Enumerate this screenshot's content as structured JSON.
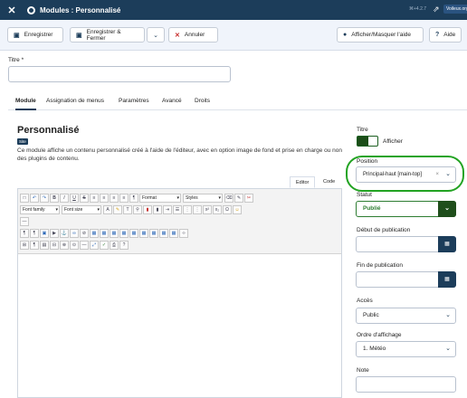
{
  "header": {
    "title": "Modules : Personnalisé",
    "version": "⌘+4.2.7",
    "site_button": "Voileux.org"
  },
  "toolbar": {
    "save": "Enregistrer",
    "save_close": "Enregistrer & Fermer",
    "cancel": "Annuler",
    "toggle_help": "Afficher/Masquer l'aide",
    "help": "Aide"
  },
  "title_field": {
    "label": "Titre *",
    "value": ""
  },
  "tabs": [
    "Module",
    "Assignation de menus",
    "Paramètres",
    "Avancé",
    "Droits"
  ],
  "module": {
    "heading": "Personnalisé",
    "badge": "Site",
    "description": "Ce module affiche un contenu personnalisé créé à l'aide de l'éditeur, avec en option image de fond et prise en charge ou non des plugins de contenu."
  },
  "editor": {
    "tabs": [
      "Editor",
      "Code"
    ],
    "selects": {
      "format": "Format",
      "styles": "Styles",
      "font_family": "Font family",
      "font_size": "Font size"
    }
  },
  "sidebar": {
    "title_label": "Titre",
    "show_label": "Afficher",
    "position_label": "Position",
    "position_value": "Principal-haut [main-top]",
    "status_label": "Statut",
    "status_value": "Publié",
    "publish_start_label": "Début de publication",
    "publish_start_value": "",
    "publish_end_label": "Fin de publication",
    "publish_end_value": "",
    "access_label": "Accès",
    "access_value": "Public",
    "order_label": "Ordre d'affichage",
    "order_value": "1. Météo",
    "note_label": "Note",
    "note_value": ""
  },
  "colors": {
    "header": "#1c3d5a",
    "status_green": "#1f4e1b",
    "annotation": "#22a322"
  }
}
